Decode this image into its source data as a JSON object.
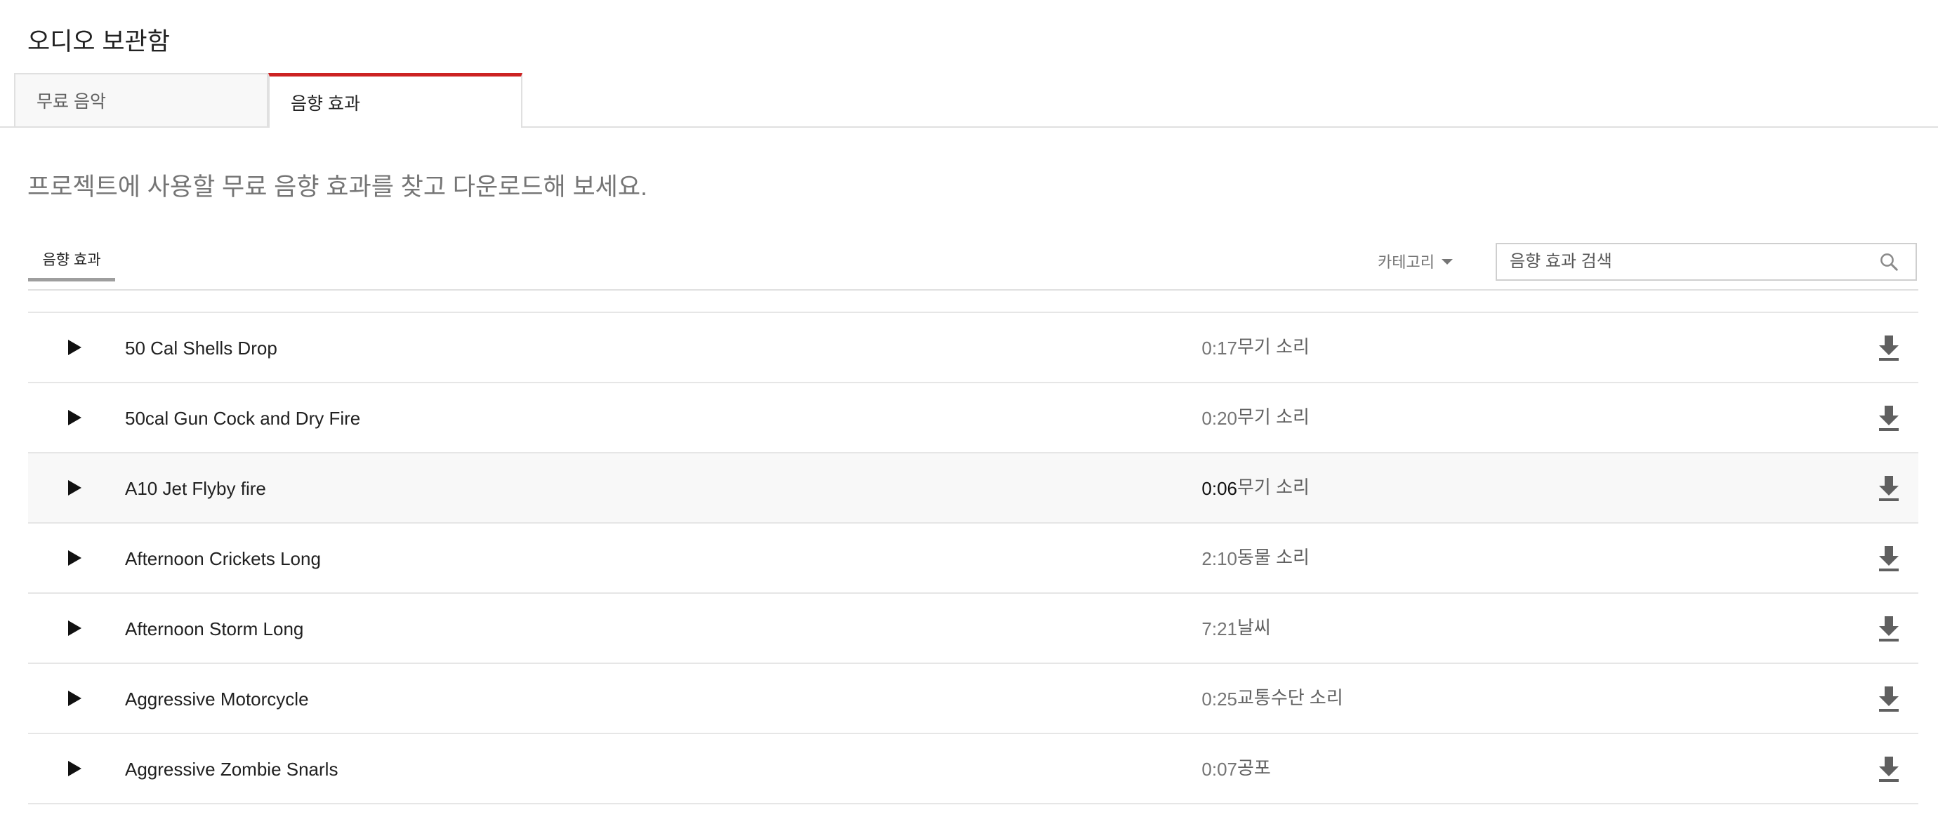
{
  "header": {
    "title": "오디오 보관함"
  },
  "tabs": [
    {
      "label": "무료 음악",
      "active": false
    },
    {
      "label": "음향 효과",
      "active": true
    }
  ],
  "description": "프로젝트에 사용할 무료 음향 효과를 찾고 다운로드해 보세요.",
  "toolbar": {
    "subtab_label": "음향 효과",
    "category_label": "카테고리",
    "search_placeholder": "음향 효과 검색"
  },
  "icons": {
    "play": "play-icon",
    "download": "download-icon",
    "search": "search-icon",
    "caret": "caret-down-icon"
  },
  "colors": {
    "accent": "#cc2222",
    "text_primary": "#212121",
    "text_secondary": "#757575",
    "icon": "#606060"
  },
  "tracks": [
    {
      "title": "50 Cal Shells Drop",
      "duration": "0:17",
      "category": "무기 소리"
    },
    {
      "title": "50cal Gun Cock and Dry Fire",
      "duration": "0:20",
      "category": "무기 소리"
    },
    {
      "title": "A10 Jet Flyby fire",
      "duration": "0:06",
      "category": "무기 소리",
      "hovered": true
    },
    {
      "title": "Afternoon Crickets Long",
      "duration": "2:10",
      "category": "동물 소리"
    },
    {
      "title": "Afternoon Storm Long",
      "duration": "7:21",
      "category": "날씨"
    },
    {
      "title": "Aggressive Motorcycle",
      "duration": "0:25",
      "category": "교통수단 소리"
    },
    {
      "title": "Aggressive Zombie Snarls",
      "duration": "0:07",
      "category": "공포"
    }
  ]
}
